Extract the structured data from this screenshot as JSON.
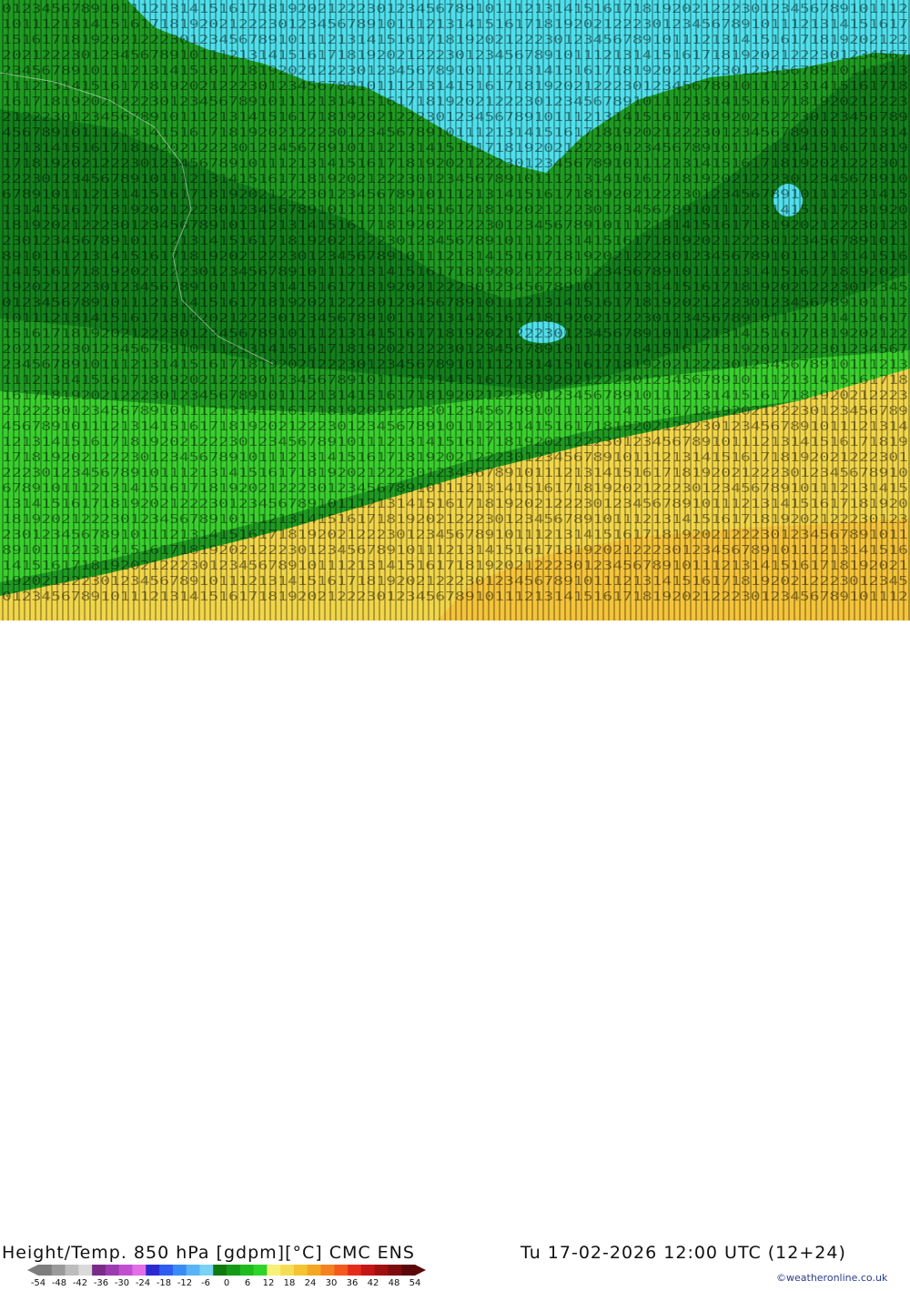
{
  "map": {
    "title": "Height/Temp. 850 hPa [gdpm][°C] CMC ENS",
    "valid_time": "Tu 17-02-2026 12:00 UTC (12+24)",
    "credit": "©weatheronline.co.uk",
    "zones": [
      {
        "name": "cold-north",
        "color": "#4fe0ec"
      },
      {
        "name": "green-dark",
        "color": "#137f1c"
      },
      {
        "name": "green-mid",
        "color": "#1f9b22"
      },
      {
        "name": "green-light",
        "color": "#39d02e"
      },
      {
        "name": "warm-south",
        "color": "#f2d64a"
      }
    ],
    "contour_digits": "01234567891011121314151617181920212223"
  },
  "legend": {
    "scale_labels": [
      "-54",
      "-48",
      "-42",
      "-36",
      "-30",
      "-24",
      "-18",
      "-12",
      "-6",
      "0",
      "6",
      "12",
      "18",
      "24",
      "30",
      "36",
      "42",
      "48",
      "54"
    ],
    "colors": [
      "#7d7d7d",
      "#9a9a9a",
      "#bdbdbd",
      "#dadada",
      "#7a2b8a",
      "#9b3bb0",
      "#c24fd0",
      "#e36ee8",
      "#2a2ad0",
      "#2c5cf0",
      "#3a8cf5",
      "#58b4f5",
      "#7ad2f5",
      "#107a10",
      "#159a18",
      "#1fbb1f",
      "#2ed42a",
      "#f7f17a",
      "#f5dd55",
      "#f4c431",
      "#f5a623",
      "#f58220",
      "#f45a1c",
      "#e52c1a",
      "#c41616",
      "#a01010",
      "#7e0c0c",
      "#5b0808"
    ]
  }
}
